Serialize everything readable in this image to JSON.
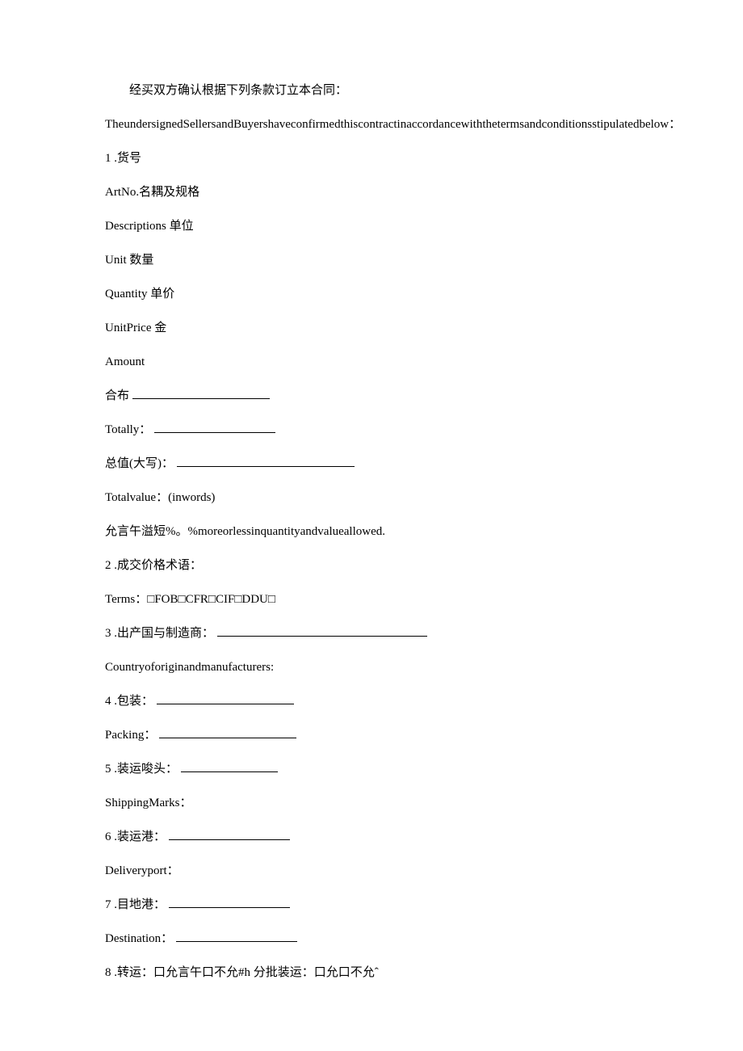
{
  "intro": {
    "cn": "经买双方确认根据下列条款订立本合同：",
    "en": "TheundersignedSellersandBuyershaveconfirmedthiscontractinaccordancewiththetermsandconditionsstipulatedbelow："
  },
  "item1": {
    "num": "1 .货号",
    "art_no": "ArtNo.名耦及规格",
    "desc": "Descriptions 单位",
    "unit": "Unit 数量",
    "qty": "Quantity 单价",
    "unitprice": "UnitPrice 金",
    "amount": "Amount",
    "hebu": "合布",
    "totally": "Totally：",
    "total_cn": "总值(大写)：",
    "total_en": "Totalvalue：(inwords)",
    "allowance": "允言午溢短%。%moreorlessinquantityandvalueallowed."
  },
  "item2": {
    "title": "2 .成交价格术语：",
    "terms": "Terms：□FOB□CFR□CIF□DDU□"
  },
  "item3": {
    "title": "3 .出产国与制造商：",
    "en": "Countryoforiginandmanufacturers:"
  },
  "item4": {
    "title": "4 .包装：",
    "en": "Packing："
  },
  "item5": {
    "title": "5 .装运唆头：",
    "en": "ShippingMarks："
  },
  "item6": {
    "title": "6 .装运港：",
    "en": "Deliveryport："
  },
  "item7": {
    "title": "7 .目地港：",
    "en": "Destination："
  },
  "item8": {
    "title": "8 .转运：口允言午口不允#h 分批装运：口允口不允ˆ"
  }
}
